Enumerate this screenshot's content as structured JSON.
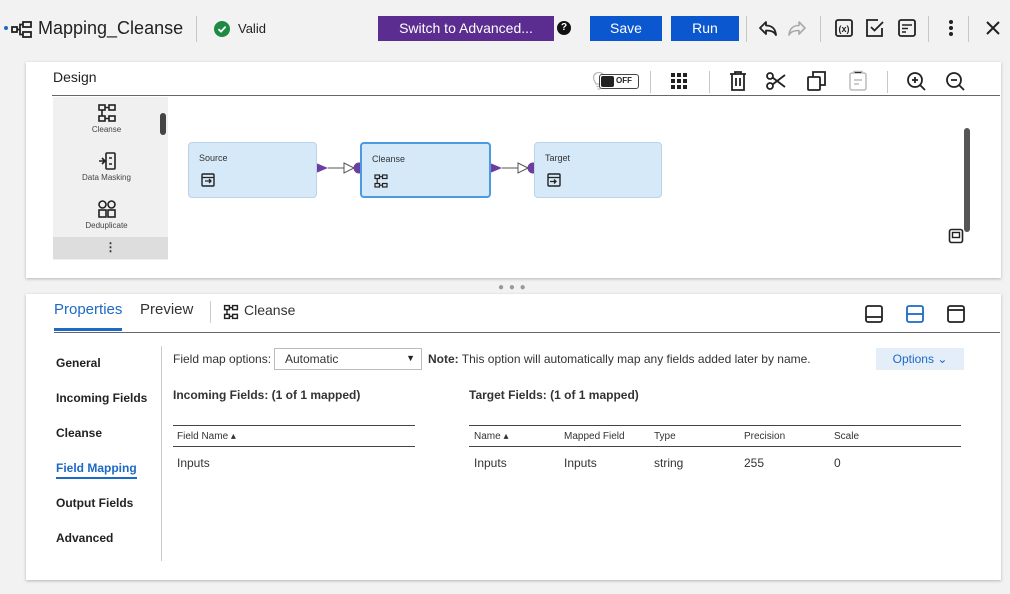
{
  "topbar": {
    "title": "Mapping_Cleanse",
    "status": "Valid",
    "switch_label": "Switch to Advanced...",
    "save_label": "Save",
    "run_label": "Run"
  },
  "design": {
    "title": "Design",
    "toggle_label": "OFF",
    "palette": {
      "items": [
        {
          "label": "Cleanse"
        },
        {
          "label": "Data Masking"
        },
        {
          "label": "Deduplicate"
        }
      ],
      "more": "⋮"
    },
    "nodes": [
      {
        "label": "Source"
      },
      {
        "label": "Cleanse"
      },
      {
        "label": "Target"
      }
    ]
  },
  "properties": {
    "tabs": [
      "Properties",
      "Preview"
    ],
    "context_label": "Cleanse",
    "side_items": [
      "General",
      "Incoming Fields",
      "Cleanse",
      "Field Mapping",
      "Output Fields",
      "Advanced"
    ],
    "field_map_label": "Field map options:",
    "field_map_value": "Automatic",
    "note_bold": "Note:",
    "note_text": " This option will automatically map any fields added later by name.",
    "options_label": "Options ⌄",
    "incoming": {
      "title": "Incoming Fields: (1 of 1 mapped)",
      "headers": [
        "Field Name ▴"
      ],
      "rows": [
        [
          "Inputs"
        ]
      ]
    },
    "target": {
      "title": "Target Fields: (1 of 1 mapped)",
      "headers": [
        "Name ▴",
        "Mapped Field",
        "Type",
        "Precision",
        "Scale"
      ],
      "rows": [
        [
          "Inputs",
          "Inputs",
          "string",
          "255",
          "0"
        ]
      ]
    }
  },
  "colors": {
    "accent": "#1d69c6",
    "primary_button": "#0b57d0",
    "advanced_button": "#5c2d91",
    "valid": "#1f8a43",
    "node_fill": "#d6e9f8",
    "link": "#6b3fa0"
  }
}
